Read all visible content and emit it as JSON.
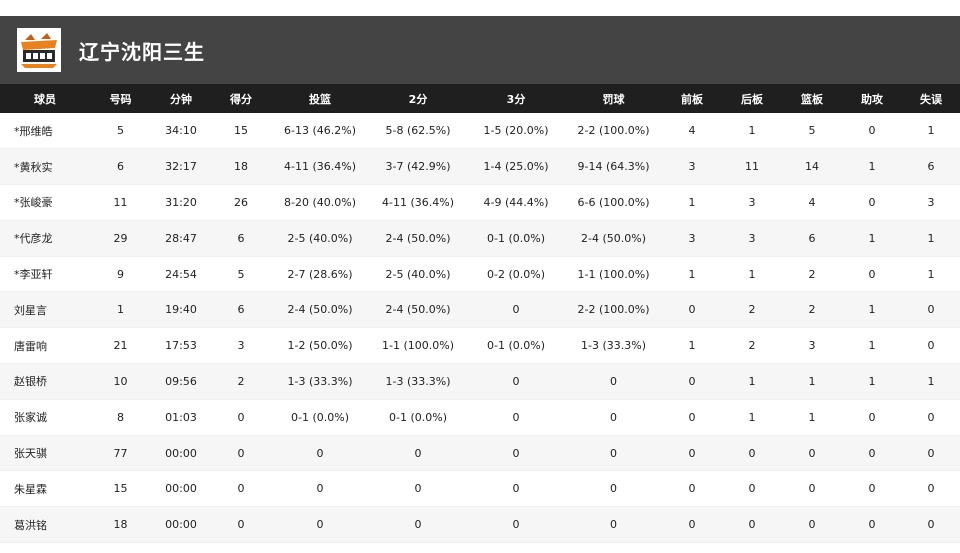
{
  "team": {
    "name": "辽宁沈阳三生"
  },
  "columns": [
    "球员",
    "号码",
    "分钟",
    "得分",
    "投篮",
    "2分",
    "3分",
    "罚球",
    "前板",
    "后板",
    "篮板",
    "助攻",
    "失误"
  ],
  "players": [
    [
      "*邢维皓",
      "5",
      "34:10",
      "15",
      "6-13 (46.2%)",
      "5-8 (62.5%)",
      "1-5 (20.0%)",
      "2-2 (100.0%)",
      "4",
      "1",
      "5",
      "0",
      "1"
    ],
    [
      "*黄秋实",
      "6",
      "32:17",
      "18",
      "4-11 (36.4%)",
      "3-7 (42.9%)",
      "1-4 (25.0%)",
      "9-14 (64.3%)",
      "3",
      "11",
      "14",
      "1",
      "6"
    ],
    [
      "*张峻豪",
      "11",
      "31:20",
      "26",
      "8-20 (40.0%)",
      "4-11 (36.4%)",
      "4-9 (44.4%)",
      "6-6 (100.0%)",
      "1",
      "3",
      "4",
      "0",
      "3"
    ],
    [
      "*代彦龙",
      "29",
      "28:47",
      "6",
      "2-5 (40.0%)",
      "2-4 (50.0%)",
      "0-1 (0.0%)",
      "2-4 (50.0%)",
      "3",
      "3",
      "6",
      "1",
      "1"
    ],
    [
      "*李亚轩",
      "9",
      "24:54",
      "5",
      "2-7 (28.6%)",
      "2-5 (40.0%)",
      "0-2 (0.0%)",
      "1-1 (100.0%)",
      "1",
      "1",
      "2",
      "0",
      "1"
    ],
    [
      "刘星言",
      "1",
      "19:40",
      "6",
      "2-4 (50.0%)",
      "2-4 (50.0%)",
      "0",
      "2-2 (100.0%)",
      "0",
      "2",
      "2",
      "1",
      "0"
    ],
    [
      "唐雷响",
      "21",
      "17:53",
      "3",
      "1-2 (50.0%)",
      "1-1 (100.0%)",
      "0-1 (0.0%)",
      "1-3 (33.3%)",
      "1",
      "2",
      "3",
      "1",
      "0"
    ],
    [
      "赵银桥",
      "10",
      "09:56",
      "2",
      "1-3 (33.3%)",
      "1-3 (33.3%)",
      "0",
      "0",
      "0",
      "1",
      "1",
      "1",
      "1"
    ],
    [
      "张家诚",
      "8",
      "01:03",
      "0",
      "0-1 (0.0%)",
      "0-1 (0.0%)",
      "0",
      "0",
      "0",
      "1",
      "1",
      "0",
      "0"
    ],
    [
      "张天骐",
      "77",
      "00:00",
      "0",
      "0",
      "0",
      "0",
      "0",
      "0",
      "0",
      "0",
      "0",
      "0"
    ],
    [
      "朱星霖",
      "15",
      "00:00",
      "0",
      "0",
      "0",
      "0",
      "0",
      "0",
      "0",
      "0",
      "0",
      "0"
    ],
    [
      "葛洪铭",
      "18",
      "00:00",
      "0",
      "0",
      "0",
      "0",
      "0",
      "0",
      "0",
      "0",
      "0",
      "0"
    ]
  ],
  "colors": {
    "team_bar": "#444444",
    "header_row": "#1f1f1f",
    "row_alt": "#f6f6f6",
    "logo_orange": "#e8821e"
  },
  "icons": {
    "logo": "team-logo-icon"
  }
}
